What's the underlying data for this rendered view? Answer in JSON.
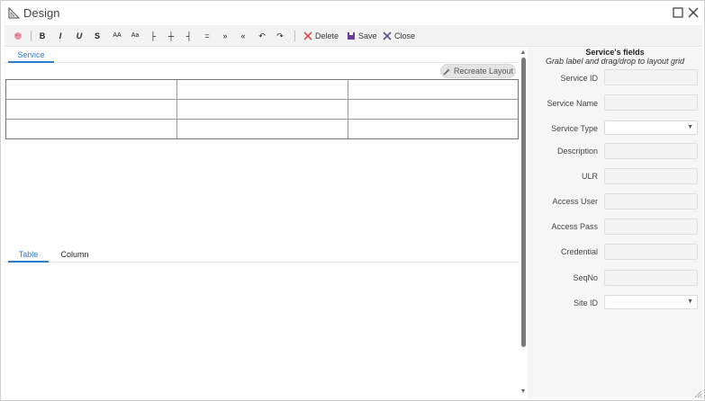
{
  "window": {
    "title": "Design"
  },
  "toolbar": {
    "bold_label": "B",
    "italic_label": "I",
    "underline_label": "U",
    "strike_label": "S",
    "font_up_label": "AA",
    "font_down_label": "Aa",
    "align_left_label": "├",
    "align_center_label": "┼",
    "align_right_label": "┤",
    "justify_label": "=",
    "indent_label": "»",
    "outdent_label": "«",
    "undo_label": "↶",
    "redo_label": "↷",
    "delete_label": "Delete",
    "save_label": "Save",
    "close_label": "Close"
  },
  "top_tabs": [
    {
      "label": "Service",
      "active": true
    }
  ],
  "recreate_button": {
    "label": "Recreate Layout"
  },
  "bottom_tabs": [
    {
      "label": "Table",
      "active": true
    },
    {
      "label": "Column",
      "active": false
    }
  ],
  "fields_panel": {
    "title": "Service's fields",
    "subtitle": "Grab label and drag/drop to layout grid",
    "fields": [
      {
        "label": "Service ID",
        "type": "input",
        "value": ""
      },
      {
        "label": "Service Name",
        "type": "input",
        "value": ""
      },
      {
        "label": "Service Type",
        "type": "select",
        "value": ""
      },
      {
        "label": "Description",
        "type": "input",
        "value": ""
      },
      {
        "label": "ULR",
        "type": "input",
        "value": ""
      },
      {
        "label": "Access User",
        "type": "input",
        "value": ""
      },
      {
        "label": "Access Pass",
        "type": "input",
        "value": ""
      },
      {
        "label": "Credential",
        "type": "input",
        "value": ""
      },
      {
        "label": "SeqNo",
        "type": "input",
        "value": ""
      },
      {
        "label": "Site ID",
        "type": "select",
        "value": ""
      }
    ]
  },
  "colors": {
    "accent": "#2f7bd0",
    "delete_icon": "#d9534f",
    "save_icon": "#6a3d9a",
    "close_icon": "#5a4fa0"
  }
}
